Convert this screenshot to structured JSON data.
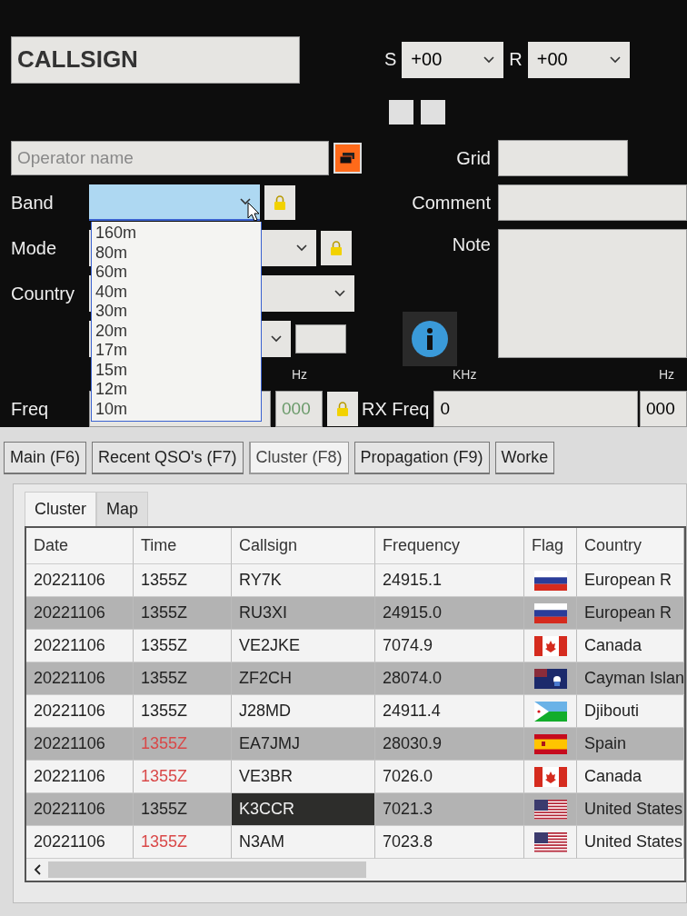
{
  "form": {
    "callsign": {
      "placeholder": "CALLSIGN"
    },
    "s_label": "S",
    "s_value": "+00",
    "r_label": "R",
    "r_value": "+00",
    "operator": {
      "placeholder": "Operator name"
    },
    "grid_label": "Grid",
    "band_label": "Band",
    "comment_label": "Comment",
    "mode_label": "Mode",
    "note_label": "Note",
    "country_label": "Country",
    "hz_label": "Hz",
    "freq_label": "Freq",
    "freq_hz": "000",
    "khz_label": "KHz",
    "rx_hz_label": "Hz",
    "rx_freq_label": "RX Freq",
    "rx_freq": "0",
    "rx_hz": "000"
  },
  "band_dropdown": {
    "expanded": true,
    "options": [
      "160m",
      "80m",
      "60m",
      "40m",
      "30m",
      "20m",
      "17m",
      "15m",
      "12m",
      "10m"
    ]
  },
  "tabs": [
    {
      "label": "Main (F6)",
      "selected": false
    },
    {
      "label": "Recent QSO's (F7)",
      "selected": false
    },
    {
      "label": "Cluster (F8)",
      "selected": true
    },
    {
      "label": "Propagation (F9)",
      "selected": false
    },
    {
      "label": "Worke",
      "selected": false
    }
  ],
  "subtabs": [
    {
      "label": "Cluster",
      "selected": true
    },
    {
      "label": "Map",
      "selected": false
    }
  ],
  "table": {
    "columns": [
      "Date",
      "Time",
      "Callsign",
      "Frequency",
      "Flag",
      "Country"
    ],
    "rows": [
      {
        "date": "20221106",
        "time": "1355Z",
        "time_alert": false,
        "callsign": "RY7K",
        "selected": false,
        "frequency": "24915.1",
        "kind": "ru",
        "country": "European R"
      },
      {
        "date": "20221106",
        "time": "1355Z",
        "time_alert": false,
        "callsign": "RU3XI",
        "selected": false,
        "frequency": "24915.0",
        "kind": "ru",
        "country": "European R"
      },
      {
        "date": "20221106",
        "time": "1355Z",
        "time_alert": false,
        "callsign": "VE2JKE",
        "selected": false,
        "frequency": "7074.9",
        "kind": "ca",
        "country": "Canada"
      },
      {
        "date": "20221106",
        "time": "1355Z",
        "time_alert": false,
        "callsign": "ZF2CH",
        "selected": false,
        "frequency": "28074.0",
        "kind": "ky",
        "country": "Cayman Islan"
      },
      {
        "date": "20221106",
        "time": "1355Z",
        "time_alert": false,
        "callsign": "J28MD",
        "selected": false,
        "frequency": "24911.4",
        "kind": "dj",
        "country": "Djibouti"
      },
      {
        "date": "20221106",
        "time": "1355Z",
        "time_alert": true,
        "callsign": "EA7JMJ",
        "selected": false,
        "frequency": "28030.9",
        "kind": "es",
        "country": "Spain"
      },
      {
        "date": "20221106",
        "time": "1355Z",
        "time_alert": true,
        "callsign": "VE3BR",
        "selected": false,
        "frequency": "7026.0",
        "kind": "ca",
        "country": "Canada"
      },
      {
        "date": "20221106",
        "time": "1355Z",
        "time_alert": false,
        "callsign": "K3CCR",
        "selected": true,
        "frequency": "7021.3",
        "kind": "us",
        "country": "United States"
      },
      {
        "date": "20221106",
        "time": "1355Z",
        "time_alert": true,
        "callsign": "N3AM",
        "selected": false,
        "frequency": "7023.8",
        "kind": "us",
        "country": "United States"
      }
    ]
  }
}
